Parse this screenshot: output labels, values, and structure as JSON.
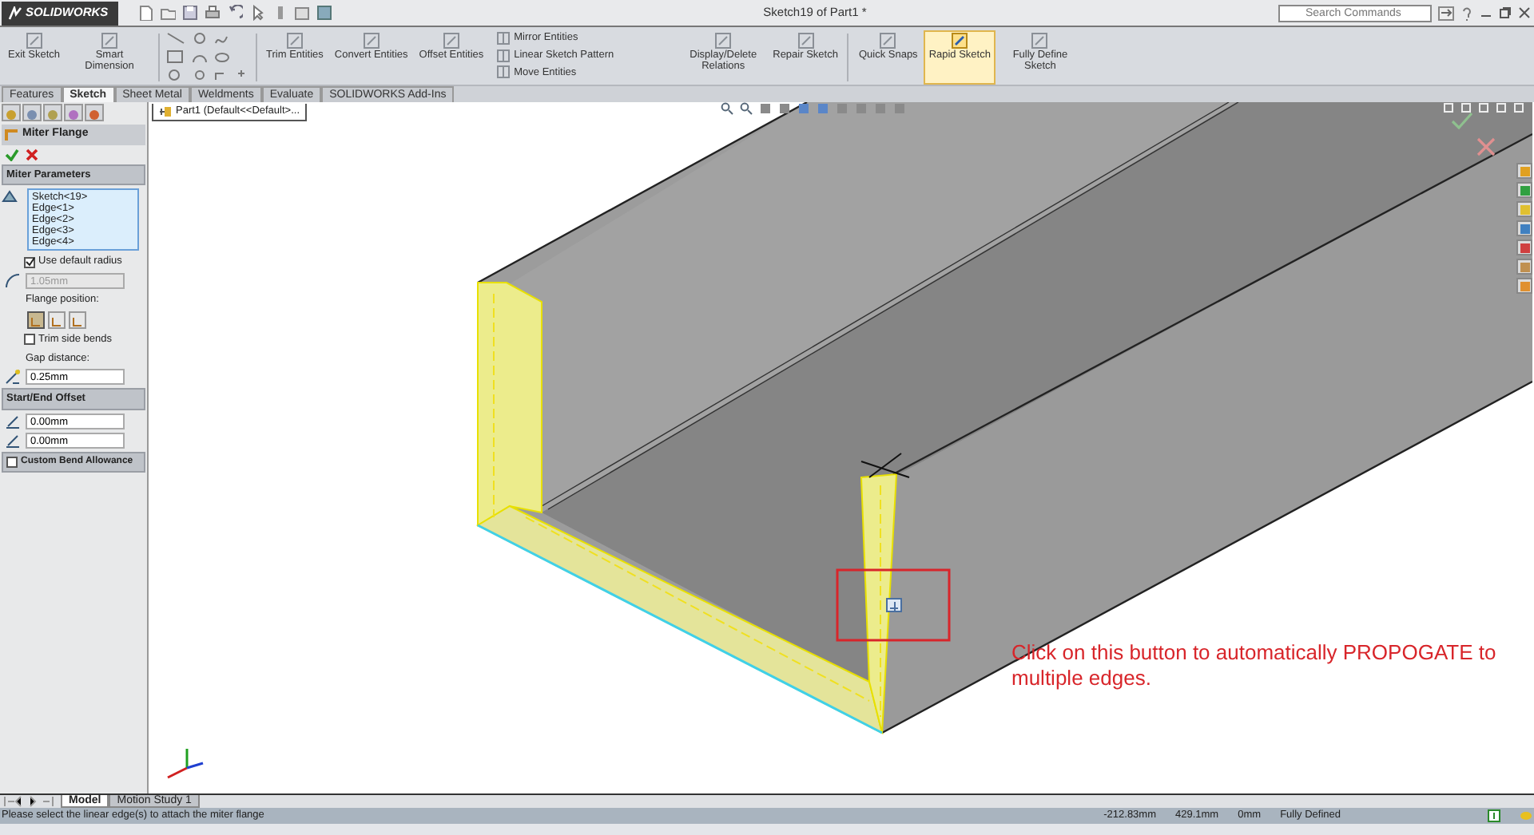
{
  "window": {
    "app_name": "SOLIDWORKS",
    "title": "Sketch19 of Part1 *"
  },
  "search": {
    "placeholder": "Search Commands"
  },
  "ribbon": {
    "tools": [
      {
        "kind": "large",
        "label": "Exit Sketch",
        "selected": false
      },
      {
        "kind": "large",
        "label": "Smart Dimension",
        "selected": false
      },
      {
        "kind": "entities"
      },
      {
        "kind": "large",
        "label": "Trim Entities",
        "selected": false
      },
      {
        "kind": "large",
        "label": "Convert Entities",
        "selected": false
      },
      {
        "kind": "large",
        "label": "Offset Entities",
        "selected": false
      },
      {
        "kind": "small",
        "label": "Mirror Entities"
      },
      {
        "kind": "small",
        "label": "Linear Sketch Pattern"
      },
      {
        "kind": "small",
        "label": "Move Entities"
      },
      {
        "kind": "large",
        "label": "Display/Delete Relations",
        "selected": false
      },
      {
        "kind": "large",
        "label": "Repair Sketch",
        "selected": false
      },
      {
        "kind": "large",
        "label": "Quick Snaps",
        "selected": false
      },
      {
        "kind": "large",
        "label": "Rapid Sketch",
        "selected": true
      },
      {
        "kind": "large",
        "label": "Fully Define Sketch",
        "selected": false
      }
    ]
  },
  "command_tabs": [
    {
      "label": "Features",
      "selected": false
    },
    {
      "label": "Sketch",
      "selected": true
    },
    {
      "label": "Sheet Metal",
      "selected": false
    },
    {
      "label": "Weldments",
      "selected": false
    },
    {
      "label": "Evaluate",
      "selected": false
    },
    {
      "label": "SOLIDWORKS Add-Ins",
      "selected": false
    }
  ],
  "property_manager": {
    "title": "Miter Flange",
    "miter_parameters": {
      "title": "Miter Parameters",
      "selections": [
        "Sketch<19>",
        "Edge<1>",
        "Edge<2>",
        "Edge<3>",
        "Edge<4>"
      ],
      "use_default_radius": {
        "label": "Use default radius",
        "checked": true
      },
      "radius": {
        "value": "1.05mm",
        "disabled": true
      },
      "flange_position": {
        "label": "Flange position:",
        "options": [
          {
            "selected": true
          },
          {
            "selected": false
          },
          {
            "selected": false
          }
        ]
      },
      "trim_side_bends": {
        "label": "Trim side bends",
        "checked": false
      },
      "gap_distance": {
        "label": "Gap distance:",
        "value": "0.25mm"
      }
    },
    "start_end_offset": {
      "title": "Start/End Offset",
      "values": [
        "0.00mm",
        "0.00mm"
      ]
    },
    "custom_bend_allowance": {
      "label": "Custom Bend Allowance",
      "checked": false
    }
  },
  "tree_flyout": {
    "label": "Part1 (Default<<Default>..."
  },
  "annotation": {
    "text": "Click on this button to automatically PROPOGATE to multiple edges."
  },
  "bottom_tabs": [
    {
      "label": "Model",
      "selected": true
    },
    {
      "label": "Motion Study 1",
      "selected": false
    }
  ],
  "status_bar": {
    "message": "Please select the linear edge(s) to attach the miter flange",
    "readouts": [
      "-212.83mm",
      "429.1mm",
      "0mm"
    ],
    "sketch_status": "Fully Defined"
  }
}
